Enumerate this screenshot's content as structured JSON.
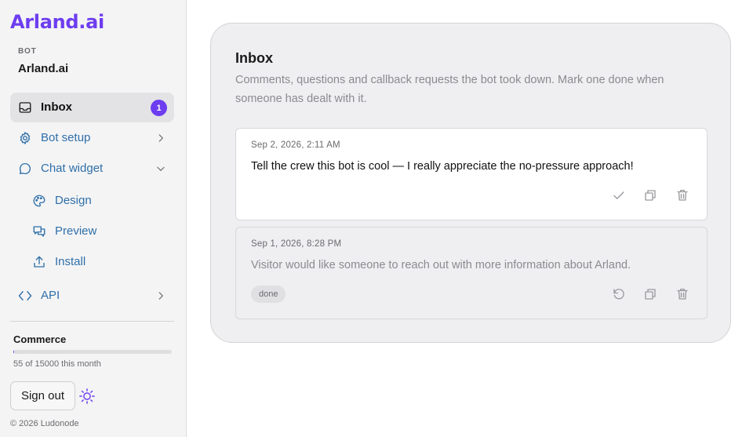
{
  "brand": {
    "logo": "Arland.ai",
    "color": "#6d3df0"
  },
  "bot": {
    "section_label": "BOT",
    "name": "Arland.ai"
  },
  "nav": {
    "inbox": {
      "label": "Inbox",
      "badge": "1",
      "icon": "inbox-icon"
    },
    "bot_setup": {
      "label": "Bot setup",
      "icon": "gear-icon"
    },
    "chat_widget": {
      "label": "Chat widget",
      "icon": "chat-bubble-icon"
    },
    "design": {
      "label": "Design",
      "icon": "palette-icon"
    },
    "preview": {
      "label": "Preview",
      "icon": "preview-icon"
    },
    "install": {
      "label": "Install",
      "icon": "upload-icon"
    },
    "api": {
      "label": "API",
      "icon": "code-icon"
    }
  },
  "plan": {
    "name": "Commerce",
    "used": 55,
    "limit": 15000,
    "usage_text": "55 of 15000 this month",
    "fraction": 0.0037
  },
  "sign_out_label": "Sign out",
  "copyright": "© 2026 Ludonode",
  "inbox": {
    "title": "Inbox",
    "description": "Comments, questions and callback requests the bot took down. Mark one done when someone has dealt with it.",
    "items": [
      {
        "time": "Sep 2, 2026, 2:11 AM",
        "message": "Tell the crew this bot is cool — I really appreciate the no-pressure approach!",
        "status": "open"
      },
      {
        "time": "Sep 1, 2026, 8:28 PM",
        "message": "Visitor would like someone to reach out with more information about Arland.",
        "status": "done",
        "status_label": "done"
      }
    ]
  }
}
